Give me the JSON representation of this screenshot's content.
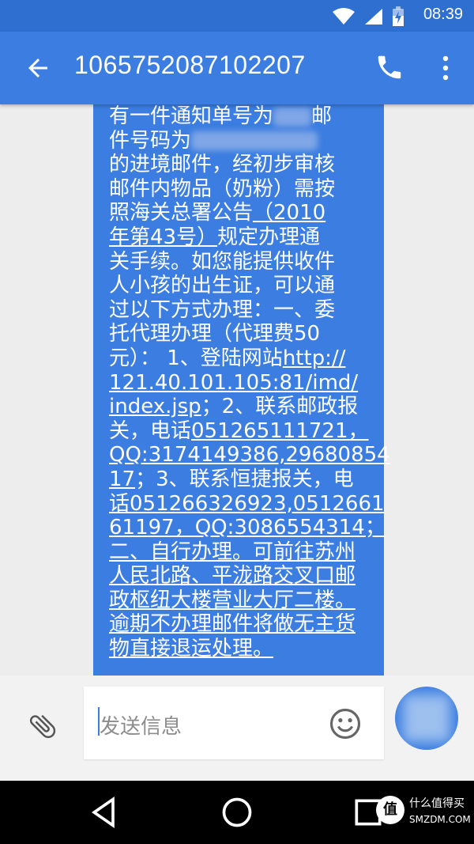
{
  "status_bar": {
    "time": "08:39",
    "icons": [
      "wifi-icon",
      "signal-icon",
      "battery-charging-icon"
    ]
  },
  "app_bar": {
    "title": "1065752087102207",
    "icons": [
      "back-arrow-icon",
      "phone-icon",
      "more-vert-icon"
    ]
  },
  "message": {
    "lines": [
      {
        "before": "有一件通知单号为",
        "after": "邮"
      },
      {
        "before": "件号码为",
        "after": ""
      },
      {
        "text": "的进境邮件，经初步审核"
      },
      {
        "text": "邮件内物品（奶粉）需按"
      },
      {
        "text": "照海关总署公告",
        "link": "（2010"
      },
      {
        "link": "年第43号）",
        "text2": "规定办理通"
      },
      {
        "text": "关手续。如您能提供收件"
      },
      {
        "text": "人小孩的出生证，可以通"
      },
      {
        "text": "过以下方式办理：一、委"
      },
      {
        "text": "托代理办理（代理费50"
      },
      {
        "text": "元）： 1、登陆网站",
        "link": "http://"
      },
      {
        "link": "121.40.101.105:81/imd/"
      },
      {
        "link": "index.jsp",
        "text2": "；2、联系邮政报"
      },
      {
        "text": "关，电话",
        "link": "051265111721，"
      },
      {
        "link": "QQ:3174149386,29680854"
      },
      {
        "link": "17",
        "text2": "；3、联系恒捷报关，电"
      },
      {
        "link": "话051266326923,0512661"
      },
      {
        "link": "61197，QQ:3086554314；"
      },
      {
        "link": "二、自行办理。可前往苏州"
      },
      {
        "link": "人民北路、平泷路交叉口邮"
      },
      {
        "link": "政枢纽大楼营业大厅二楼。"
      },
      {
        "link": "逾期不办理邮件将做无主货"
      },
      {
        "link": "物直接退运处理。"
      }
    ]
  },
  "composer": {
    "placeholder": "发送信息",
    "icons": [
      "attach-icon",
      "emoji-icon",
      "avatar"
    ]
  },
  "nav_bar": {
    "icons": [
      "back-triangle-icon",
      "home-circle-icon",
      "recents-square-icon"
    ]
  },
  "watermark": {
    "logo": "值",
    "line1": "什么值得买",
    "line2": "SMZDM.COM"
  },
  "colors": {
    "primary": "#3b7de0",
    "status_bar": "#2f6fd0",
    "background": "#ededed"
  }
}
